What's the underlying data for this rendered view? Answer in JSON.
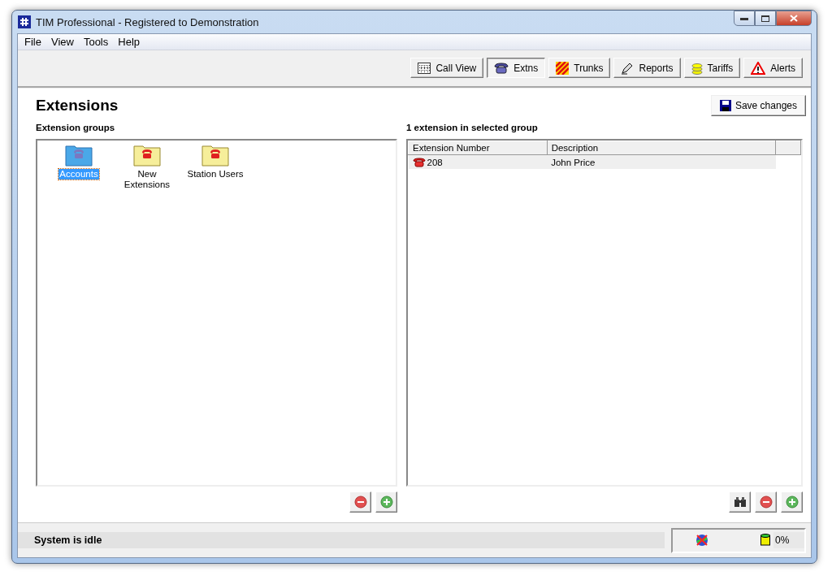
{
  "window": {
    "title": "TIM Professional - Registered to Demonstration"
  },
  "menu": [
    "File",
    "View",
    "Tools",
    "Help"
  ],
  "toolbar": [
    {
      "label": "Call View",
      "kind": "grid",
      "selected": false
    },
    {
      "label": "Extns",
      "kind": "phone",
      "selected": true
    },
    {
      "label": "Trunks",
      "kind": "stripes",
      "selected": false
    },
    {
      "label": "Reports",
      "kind": "pen",
      "selected": false
    },
    {
      "label": "Tariffs",
      "kind": "coins",
      "selected": false
    },
    {
      "label": "Alerts",
      "kind": "warning",
      "selected": false
    }
  ],
  "page": {
    "heading": "Extensions",
    "save_button": "Save changes"
  },
  "groups": {
    "title": "Extension groups",
    "items": [
      {
        "label": "Accounts",
        "selected": true
      },
      {
        "label": "New Extensions",
        "selected": false
      },
      {
        "label": "Station Users",
        "selected": false
      }
    ]
  },
  "extensions": {
    "title": "1 extension in selected group",
    "columns": [
      "Extension Number",
      "Description"
    ],
    "rows": [
      {
        "number": "208",
        "description": "John Price",
        "selected": true
      }
    ]
  },
  "status_bar": {
    "message": "System is idle",
    "percent": "0%"
  }
}
